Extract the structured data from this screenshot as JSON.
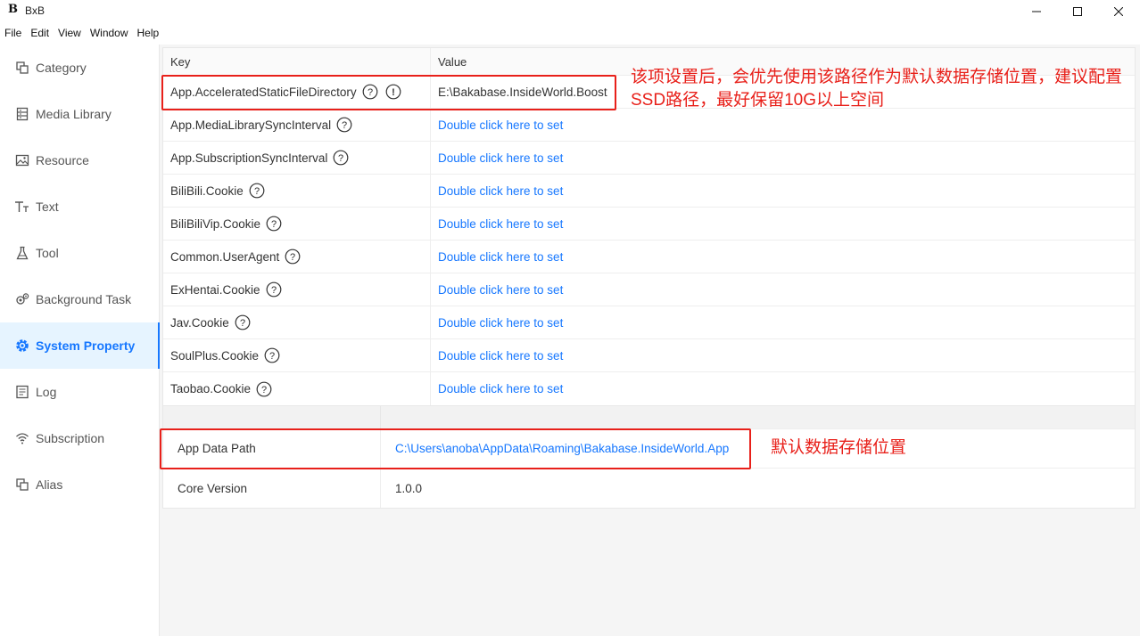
{
  "app": {
    "logo": "B",
    "title": "BxB"
  },
  "menu": [
    "File",
    "Edit",
    "View",
    "Window",
    "Help"
  ],
  "sidebar": {
    "items": [
      {
        "label": "Category",
        "icon": "category-icon"
      },
      {
        "label": "Media Library",
        "icon": "media-library-icon"
      },
      {
        "label": "Resource",
        "icon": "image-icon"
      },
      {
        "label": "Text",
        "icon": "text-icon"
      },
      {
        "label": "Tool",
        "icon": "flask-icon"
      },
      {
        "label": "Background Task",
        "icon": "gears-icon"
      },
      {
        "label": "System Property",
        "icon": "settings-icon",
        "active": true
      },
      {
        "label": "Log",
        "icon": "log-icon"
      },
      {
        "label": "Subscription",
        "icon": "wifi-icon"
      },
      {
        "label": "Alias",
        "icon": "alias-icon"
      }
    ]
  },
  "properties": {
    "header": {
      "key": "Key",
      "value": "Value"
    },
    "rows": [
      {
        "key": "App.AcceleratedStaticFileDirectory",
        "value": "E:\\Bakabase.InsideWorld.Boost",
        "warning": true
      },
      {
        "key": "App.MediaLibrarySyncInterval",
        "value": "Double click here to set"
      },
      {
        "key": "App.SubscriptionSyncInterval",
        "value": "Double click here to set"
      },
      {
        "key": "BiliBili.Cookie",
        "value": "Double click here to set"
      },
      {
        "key": "BiliBiliVip.Cookie",
        "value": "Double click here to set"
      },
      {
        "key": "Common.UserAgent",
        "value": "Double click here to set"
      },
      {
        "key": "ExHentai.Cookie",
        "value": "Double click here to set"
      },
      {
        "key": "Jav.Cookie",
        "value": "Double click here to set"
      },
      {
        "key": "SoulPlus.Cookie",
        "value": "Double click here to set"
      },
      {
        "key": "Taobao.Cookie",
        "value": "Double click here to set"
      }
    ]
  },
  "app_info": {
    "rows": [
      {
        "key": "App Data Path",
        "value": "C:\\Users\\anoba\\AppData\\Roaming\\Bakabase.InsideWorld.App",
        "link": true
      },
      {
        "key": "Core Version",
        "value": "1.0.0",
        "link": false
      }
    ]
  },
  "annotations": {
    "boost_note": "该项设置后，会优先使用该路径作为默认数据存储位置，建议配置SSD路径，最好保留10G以上空间",
    "app_data_note": "默认数据存储位置"
  },
  "colors": {
    "accent": "#1677ff",
    "annotation": "#e8201a"
  }
}
